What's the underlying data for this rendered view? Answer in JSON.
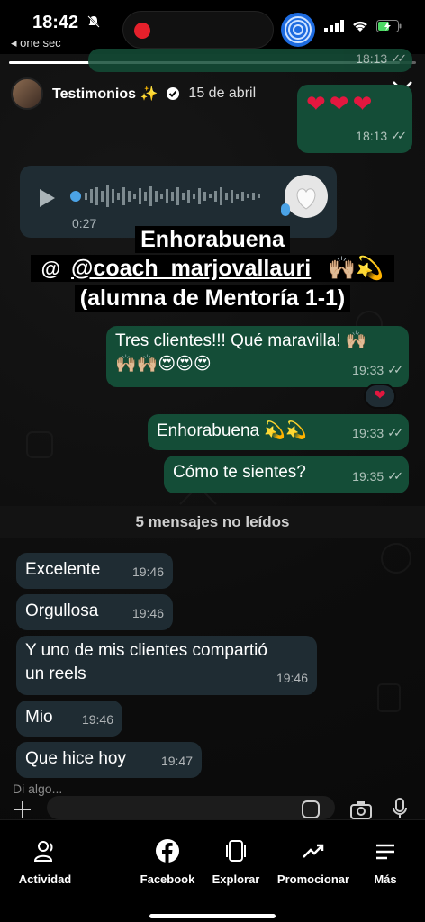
{
  "status_bar": {
    "time": "18:42",
    "back_app": "◂ one sec"
  },
  "story": {
    "account_name": "Testimonios ✨",
    "date": "15 de abril",
    "caption_line1": "Enhorabuena",
    "caption_mention": "@coach_marjovallauri",
    "caption_emoji": " 🙌🏼💫",
    "caption_line3": "(alumna de Mentoría 1-1)"
  },
  "chat": {
    "outgoing": [
      {
        "text": "",
        "time": "18:13"
      },
      {
        "text": "❤❤❤",
        "time": "18:13"
      },
      {
        "text": "Tres clientes!!! Qué maravilla! 🙌🏼",
        "text2": "🙌🏼🙌🏼😍😍😍",
        "time": "19:33"
      },
      {
        "text": "Enhorabuena 💫💫",
        "time": "19:33"
      },
      {
        "text": "Cómo te sientes?",
        "time": "19:35"
      }
    ],
    "voice_note": {
      "duration": "0:27"
    },
    "reaction": "❤",
    "unread_divider": "5 mensajes no leídos",
    "incoming": [
      {
        "text": "Excelente",
        "time": "19:46"
      },
      {
        "text": "Orgullosa",
        "time": "19:46"
      },
      {
        "text": "Y uno de mis clientes compartió",
        "text2": "un reels",
        "time": "19:46"
      },
      {
        "text": "Mio",
        "time": "19:46"
      },
      {
        "text": "Que hice hoy",
        "time": "19:47"
      }
    ],
    "reply_placeholder": "Di algo..."
  },
  "tabs": [
    {
      "label": "Actividad",
      "icon": "person-wave-icon"
    },
    {
      "label": "Facebook",
      "icon": "facebook-icon"
    },
    {
      "label": "Explorar",
      "icon": "explore-cards-icon"
    },
    {
      "label": "Promocionar",
      "icon": "trend-arrow-icon"
    },
    {
      "label": "Más",
      "icon": "menu-lines-icon"
    }
  ],
  "colors": {
    "outgoing_bubble": "#144d37",
    "incoming_bubble": "#1f2c33",
    "heart": "#e3173f",
    "record_dot": "#e5202b"
  }
}
